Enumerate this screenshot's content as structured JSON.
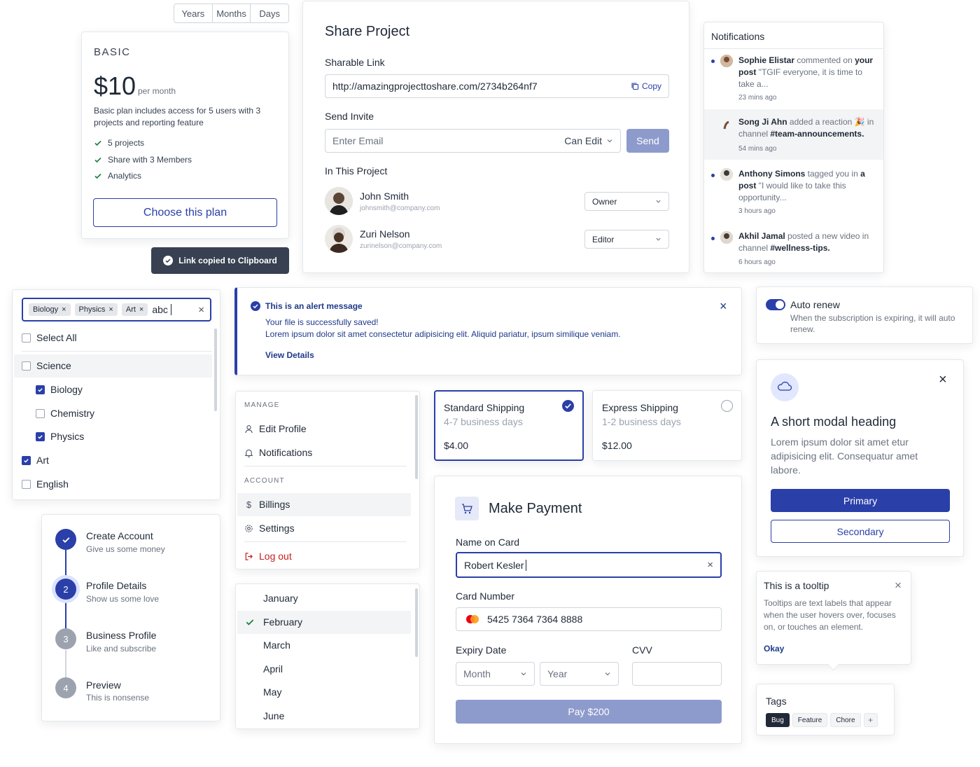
{
  "tabs": [
    "Years",
    "Months",
    "Days"
  ],
  "plan": {
    "name": "BASIC",
    "price": "$10",
    "period": "per month",
    "description": "Basic plan includes access for 5 users with 3 projects and reporting feature",
    "features": [
      "5 projects",
      "Share with 3 Members",
      "Analytics"
    ],
    "cta": "Choose this plan"
  },
  "toast": {
    "text": "Link copied to Clipboard"
  },
  "share": {
    "title": "Share Project",
    "link_label": "Sharable Link",
    "link_value": "http://amazingprojecttoshare.com/2734b264nf7",
    "copy_label": "Copy",
    "invite_label": "Send Invite",
    "email_placeholder": "Enter Email",
    "permission": "Can Edit",
    "send_label": "Send",
    "members_label": "In This Project",
    "members": [
      {
        "name": "John Smith",
        "email": "johnsmith@company.com",
        "role": "Owner"
      },
      {
        "name": "Zuri Nelson",
        "email": "zurinelson@company.com",
        "role": "Editor"
      }
    ]
  },
  "notifications": {
    "title": "Notifications",
    "items": [
      {
        "name": "Sophie Elistar",
        "rest": " commented on ",
        "bold2": "your post",
        "line2": " \"TGIF everyone, it is time to",
        "line3": "take a...",
        "time": "23 mins ago"
      },
      {
        "name": "Song Ji Ahn",
        "rest": " added a reaction 🎉 in",
        "line2": "channel ",
        "bold2": "#team-announcements.",
        "time": "54 mins ago"
      },
      {
        "name": "Anthony Simons",
        "rest": " tagged you in ",
        "bold2": "a",
        "line2": "post",
        "line2b": " \"I would like to take this",
        "line3": "opportunity...",
        "time": "3 hours ago"
      },
      {
        "name": "Akhil Jamal",
        "rest": " posted a new video in",
        "line2": "channel ",
        "bold2": "#wellness-tips.",
        "time": "6 hours ago"
      }
    ]
  },
  "multiselect": {
    "chips": [
      "Biology",
      "Physics",
      "Art"
    ],
    "query": "abc",
    "options": [
      {
        "label": "Select All",
        "checked": false,
        "indent": false
      },
      {
        "label": "Science",
        "checked": false,
        "indent": false
      },
      {
        "label": "Biology",
        "checked": true,
        "indent": true
      },
      {
        "label": "Chemistry",
        "checked": false,
        "indent": true
      },
      {
        "label": "Physics",
        "checked": true,
        "indent": true
      },
      {
        "label": "Art",
        "checked": true,
        "indent": false
      },
      {
        "label": "English",
        "checked": false,
        "indent": false
      }
    ]
  },
  "alert": {
    "title": "This is an alert message",
    "line1": "Your file is successfully saved!",
    "line2": "Lorem ipsum dolor sit amet consectetur adipisicing elit. Aliquid pariatur, ipsum similique veniam.",
    "link": "View Details"
  },
  "autorenew": {
    "label": "Auto renew",
    "description": "When the subscription is expiring, it will auto renew."
  },
  "menu": {
    "manage_label": "MANAGE",
    "edit_profile": "Edit Profile",
    "notifications": "Notifications",
    "account_label": "ACCOUNT",
    "billings": "Billings",
    "settings": "Settings",
    "logout": "Log out"
  },
  "shipping": [
    {
      "title": "Standard Shipping",
      "eta": "4-7 business days",
      "price": "$4.00",
      "selected": true
    },
    {
      "title": "Express Shipping",
      "eta": "1-2 business days",
      "price": "$12.00",
      "selected": false
    }
  ],
  "modal": {
    "heading": "A short modal heading",
    "body": "Lorem ipsum dolor sit amet etur adipisicing elit. Consequatur amet labore.",
    "primary": "Primary",
    "secondary": "Secondary"
  },
  "stepper": [
    {
      "num": "1",
      "title": "Create Account",
      "sub": "Give us some money",
      "state": "done"
    },
    {
      "num": "2",
      "title": "Profile Details",
      "sub": "Show us some love",
      "state": "active"
    },
    {
      "num": "3",
      "title": "Business Profile",
      "sub": "Like and subscribe",
      "state": "todo"
    },
    {
      "num": "4",
      "title": "Preview",
      "sub": "This is nonsense",
      "state": "todo"
    }
  ],
  "months": {
    "items": [
      "January",
      "February",
      "March",
      "April",
      "May",
      "June"
    ],
    "selected": "February"
  },
  "payment": {
    "title": "Make Payment",
    "name_label": "Name on Card",
    "name_value": "Robert Kesler",
    "card_label": "Card Number",
    "card_value": "5425 7364 7364 8888",
    "expiry_label": "Expiry Date",
    "month_placeholder": "Month",
    "year_placeholder": "Year",
    "cvv_label": "CVV",
    "pay_label": "Pay $200"
  },
  "tooltip": {
    "title": "This is a tooltip",
    "body": "Tooltips are text labels that appear when the user hovers over, focuses on, or touches an element.",
    "action": "Okay"
  },
  "tags": {
    "title": "Tags",
    "items": [
      "Bug",
      "Feature",
      "Chore"
    ],
    "add": "+"
  },
  "colors": {
    "accent": "#2a3fa8",
    "danger": "#c81e1e",
    "pay_disabled": "#8d9bcc"
  }
}
